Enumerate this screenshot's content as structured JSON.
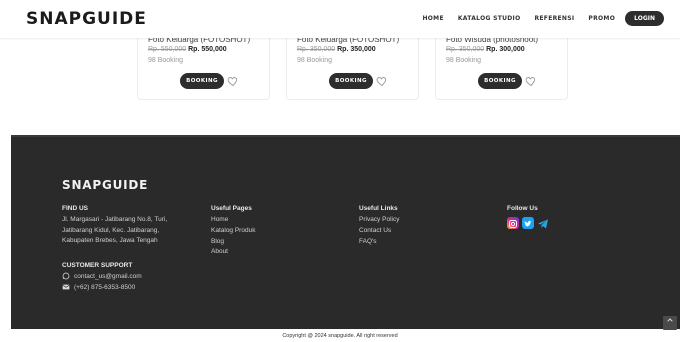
{
  "header": {
    "logo": "SNAPGUIDE",
    "nav": [
      "HOME",
      "KATALOG STUDIO",
      "REFERENSI",
      "PROMO"
    ],
    "login": "LOGIN"
  },
  "cards": [
    {
      "title": "Foto Keluarga (FOTOSHOT)",
      "old_price": "Rp. 550,000",
      "new_price": "Rp. 550,000",
      "count": "98 Booking",
      "button": "BOOKING"
    },
    {
      "title": "Foto Keluarga (FOTOSHOT)",
      "old_price": "Rp. 350,000",
      "new_price": "Rp. 350,000",
      "count": "98 Booking",
      "button": "BOOKING"
    },
    {
      "title": "Foto Wisuda (photoshoot)",
      "old_price": "Rp. 350,000",
      "new_price": "Rp. 300,000",
      "count": "98 Booking",
      "button": "BOOKING"
    }
  ],
  "footer": {
    "logo": "SNAPGUIDE",
    "find_us": {
      "heading": "FIND US",
      "lines": [
        "Jl. Margasari - Jatibarang No.8, Turi,",
        "Jatibarang Kidul, Kec. Jatibarang,",
        "Kabupaten Brebes, Jawa Tengah"
      ]
    },
    "support": {
      "heading": "CUSTOMER SUPPORT",
      "email": "contact_us@gmail.com",
      "phone": "(+62) 875-6353-8500"
    },
    "useful_pages": {
      "heading": "Useful Pages",
      "links": [
        "Home",
        "Katalog Produk",
        "Blog",
        "About"
      ]
    },
    "useful_links": {
      "heading": "Useful Links",
      "links": [
        "Privacy Policy",
        "Contact Us",
        "FAQ's"
      ]
    },
    "follow_us": {
      "heading": "Follow Us",
      "icons": [
        "instagram-icon",
        "twitter-icon",
        "telegram-icon"
      ]
    }
  },
  "copyright": "Copyright @ 2024 snapguide. All right reserved",
  "colors": {
    "dark": "#2d2d2d",
    "footer_bg": "#2a2a2a",
    "instagram": "#d6249f",
    "twitter": "#1da1f2",
    "telegram": "#2aa4e0"
  }
}
